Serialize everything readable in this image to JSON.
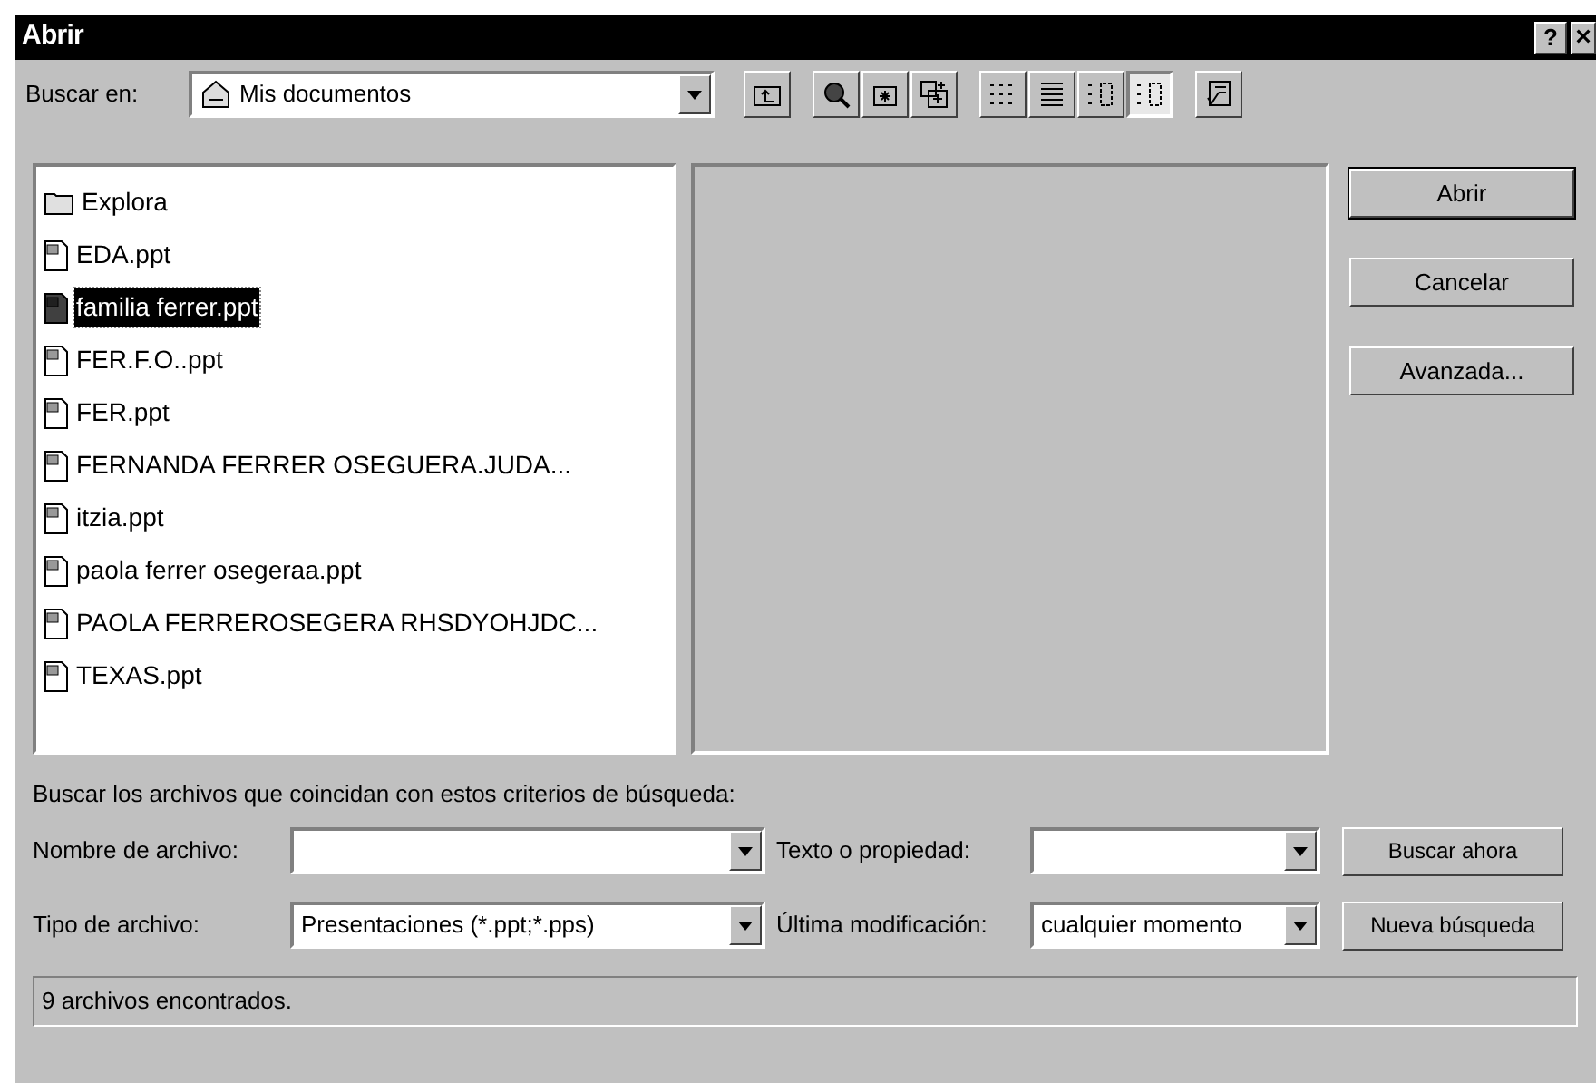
{
  "window": {
    "title": "Abrir",
    "help": "?",
    "close": "×"
  },
  "look_in": {
    "label": "Buscar en:",
    "value": "Mis documentos"
  },
  "toolbar": [
    {
      "kind": "up",
      "selected": false
    },
    {
      "kind": "web",
      "selected": false
    },
    {
      "kind": "favorites",
      "selected": false
    },
    {
      "kind": "add",
      "selected": false
    },
    {
      "kind": "list",
      "selected": false
    },
    {
      "kind": "details",
      "selected": false
    },
    {
      "kind": "properties",
      "selected": false
    },
    {
      "kind": "preview",
      "selected": true
    },
    {
      "kind": "commands",
      "selected": false
    }
  ],
  "files": [
    {
      "name": "Explora",
      "kind": "folder",
      "selected": false
    },
    {
      "name": "EDA.ppt",
      "kind": "ppt",
      "selected": false
    },
    {
      "name": "familia  ferrer.ppt",
      "kind": "ppt",
      "selected": true
    },
    {
      "name": "FER.F.O..ppt",
      "kind": "ppt",
      "selected": false
    },
    {
      "name": "FER.ppt",
      "kind": "ppt",
      "selected": false
    },
    {
      "name": "FERNANDA  FERRER   OSEGUERA.JUDA...",
      "kind": "ppt",
      "selected": false
    },
    {
      "name": "itzia.ppt",
      "kind": "ppt",
      "selected": false
    },
    {
      "name": "paola  ferrer  osegeraa.ppt",
      "kind": "ppt",
      "selected": false
    },
    {
      "name": "PAOLA FERREROSEGERA  RHSDYOHJDC...",
      "kind": "ppt",
      "selected": false
    },
    {
      "name": "TEXAS.ppt",
      "kind": "ppt",
      "selected": false
    }
  ],
  "buttons": [
    "Abrir",
    "Cancelar",
    "Avanzada..."
  ],
  "criteria": {
    "heading": "Buscar los archivos que coincidan con estos criterios de búsqueda:",
    "file_name": {
      "label": "Nombre de archivo:"
    },
    "text": {
      "label": "Texto o propiedad:"
    },
    "file_type": {
      "label": "Tipo de archivo:",
      "value": "Presentaciones (*.ppt;*.pps)"
    },
    "modified": {
      "label": "Última modificación:",
      "value": "cualquier momento"
    },
    "buttons": [
      "Buscar ahora",
      "Nueva búsqueda"
    ]
  },
  "status_bar": "9 archivos encontrados."
}
